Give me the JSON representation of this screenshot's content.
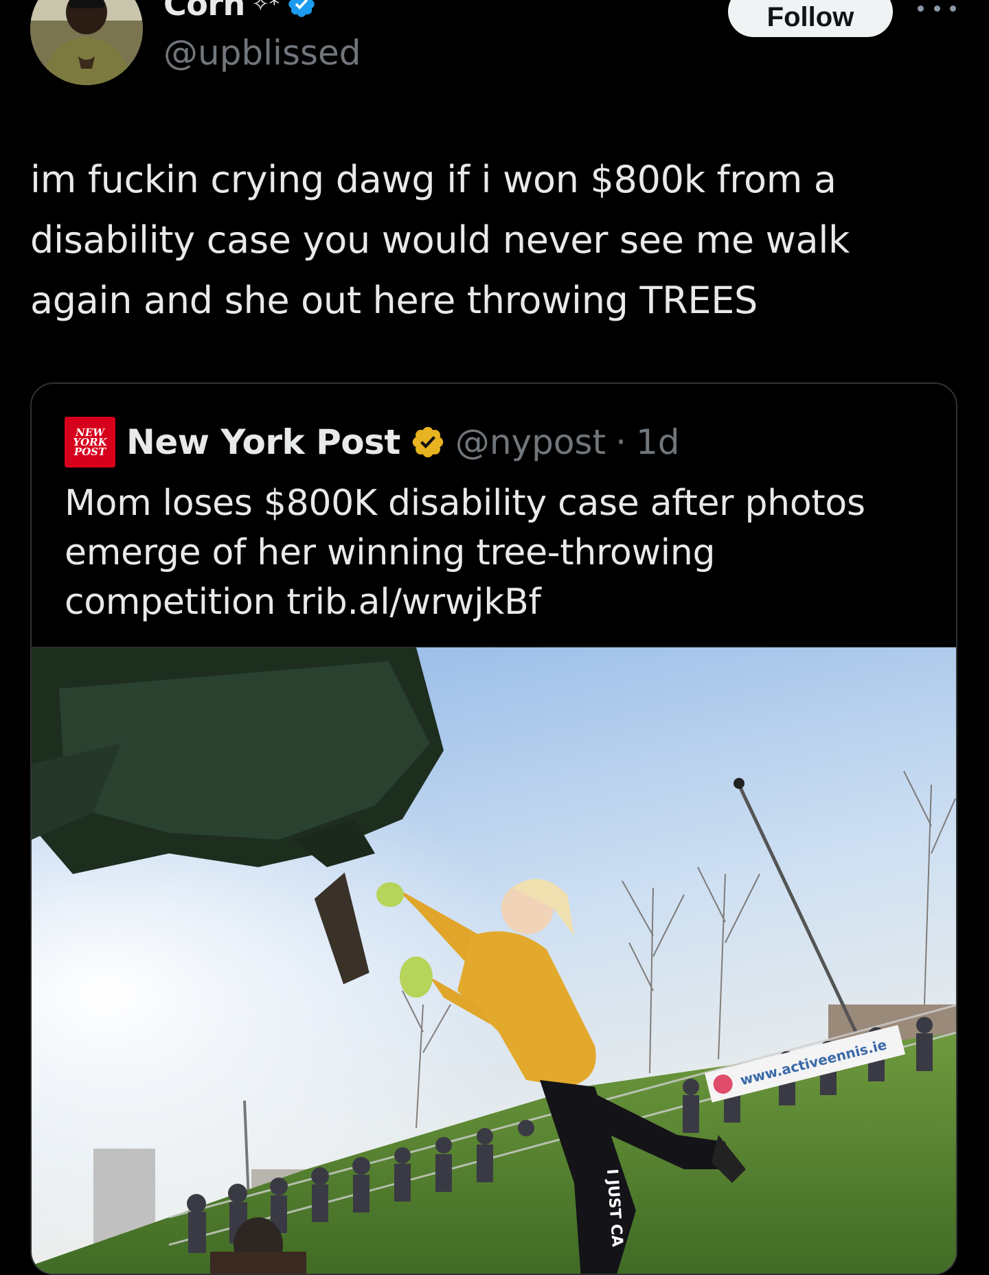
{
  "author": {
    "display_name": "Corn",
    "sparkle": "✧*",
    "handle": "@upblissed",
    "avatar_icon": "user-avatar-photo",
    "verified_icon": "verified-blue-badge-icon",
    "verified_color": "#1d9bf0"
  },
  "follow_label": "Follow",
  "more_icon": "more-options-icon",
  "tweet": {
    "text": "im fuckin crying dawg if i won $800k from a disability case you would never see me walk again and she out here throwing TREES"
  },
  "quoted": {
    "logo_lines": [
      "NEW",
      "YORK",
      "POST"
    ],
    "logo_color": "#d6001c",
    "display_name": "New York Post",
    "verified_icon": "verified-gold-badge-icon",
    "verified_color": "#e8b321",
    "handle": "@nypost",
    "separator": "·",
    "time": "1d",
    "text": "Mom loses $800K disability case after photos emerge of her winning tree-throwing competition trib.al/wrwjkBf",
    "photo": {
      "banner_text": "www.activeennis.ie",
      "leggings_text": "I JUST CA"
    }
  }
}
